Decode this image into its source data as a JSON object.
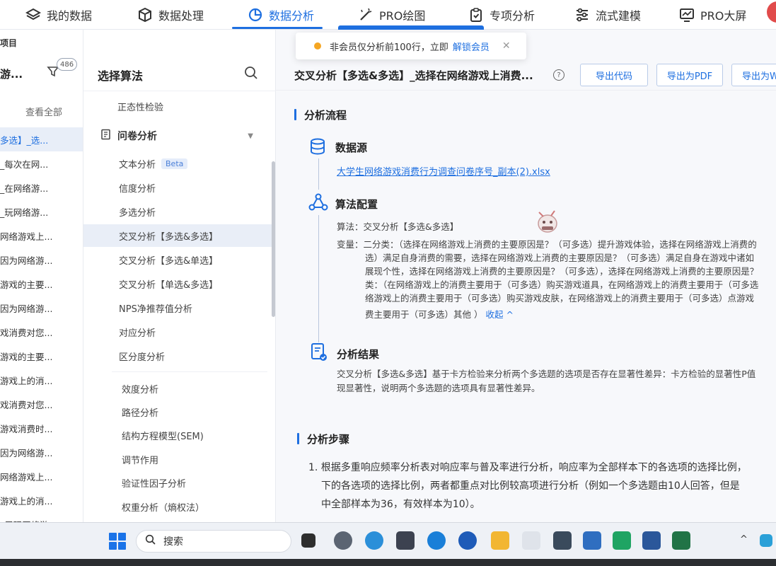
{
  "nav": {
    "items": [
      {
        "label": "我的数据",
        "icon": "layers-icon"
      },
      {
        "label": "数据处理",
        "icon": "cube-icon"
      },
      {
        "label": "数据分析",
        "icon": "pie-chart-icon",
        "active": true
      },
      {
        "label": "PRO绘图",
        "icon": "magic-wand-icon"
      },
      {
        "label": "专项分析",
        "icon": "clipboard-check-icon"
      },
      {
        "label": "流式建模",
        "icon": "sliders-icon"
      },
      {
        "label": "PRO大屏",
        "icon": "monitor-chart-icon"
      }
    ],
    "accent": "#1e6fe0"
  },
  "toast": {
    "text": "非会员仅分析前100行，立即",
    "link": "解锁会员"
  },
  "projects": {
    "header": "项目",
    "name": "游...",
    "badge": "486",
    "view_all": "查看全部",
    "items": [
      "多选】_选...",
      "_每次在网...",
      "_在网络游...",
      "_玩网络游...",
      "网络游戏上...",
      "因为网络游...",
      "游戏的主要...",
      "因为网络游...",
      "戏消费对您...",
      "游戏的主要...",
      "游戏上的消...",
      "戏消费对您...",
      "游戏消费时...",
      "因为网络游...",
      "网络游戏上...",
      "游戏上的消...",
      "_周玩网络游..."
    ]
  },
  "algorithms": {
    "title": "选择算法",
    "top_item": "正态性检验",
    "group": "问卷分析",
    "items": [
      {
        "label": "文本分析",
        "beta": "Beta"
      },
      {
        "label": "信度分析"
      },
      {
        "label": "多选分析"
      },
      {
        "label": "交叉分析【多选&多选】",
        "selected": true
      },
      {
        "label": "交叉分析【多选&单选】"
      },
      {
        "label": "交叉分析【单选&多选】"
      },
      {
        "label": "NPS净推荐值分析"
      },
      {
        "label": "对应分析"
      },
      {
        "label": "区分度分析"
      }
    ],
    "more_items": [
      "效度分析",
      "路径分析",
      "结构方程模型(SEM)",
      "调节作用",
      "验证性因子分析",
      "权重分析（熵权法）"
    ]
  },
  "main": {
    "title": "交叉分析【多选&多选】_选择在网络游戏上消费...",
    "buttons": {
      "export_code": "导出代码",
      "export_pdf": "导出为PDF",
      "export_word": "导出为W"
    },
    "flow_title": "分析流程",
    "datasource_label": "数据源",
    "datasource_file": "大学生网络游戏消费行为调查问卷序号_副本(2).xlsx",
    "config_label": "算法配置",
    "algorithm_line": "算法：交叉分析【多选&多选】",
    "variable_lines": [
      "变量：二分类：（选择在网络游戏上消费的主要原因是？（可多选）提升游戏体验，选择在网络游戏上消费的",
      "选）满足自身消费的需要，选择在网络游戏上消费的主要原因是？（可多选）满足自身在游戏中诸如",
      "展现个性，选择在网络游戏上消费的主要原因是？（可多选），选择在网络游戏上消费的主要原因是？",
      "类：（在网络游戏上的消费主要用于（可多选）购买游戏道具，在网络游戏上的消费主要用于（可多选",
      "络游戏上的消费主要用于（可多选）购买游戏皮肤，在网络游戏上的消费主要用于（可多选）点游戏",
      "费主要用于（可多选）其他 ）"
    ],
    "collapse": "收起 ^",
    "result_label": "分析结果",
    "result_lines": [
      "交叉分析【多选&多选】基于卡方检验来分析两个多选题的选项是否存在显著性差异：卡方检验的显著性P值",
      "现显著性，说明两个多选题的选项具有显著性差异。"
    ],
    "steps_title": "分析步骤",
    "step_lines": [
      "1. 根据多重响应频率分析表对响应率与普及率进行分析，响应率为全部样本下的各选项的选择比例，",
      "下的各选项的选择比例，两者都重点对比例较高项进行分析（例如一个多选题由10人回答，但是",
      "中全部样本为36，有效样本为10）。"
    ]
  },
  "taskbar": {
    "search": "搜索"
  }
}
